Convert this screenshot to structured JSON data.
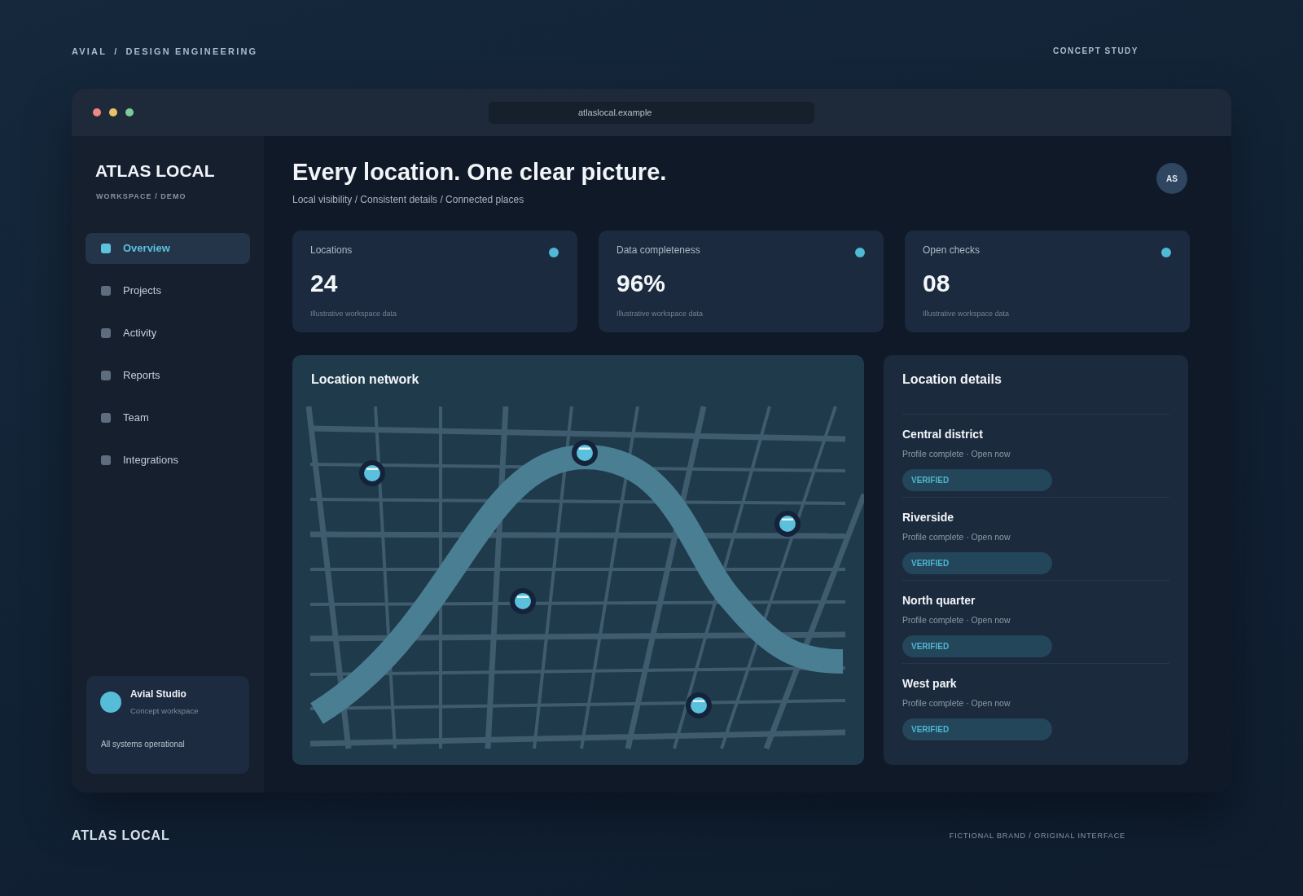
{
  "top_bar": {
    "brand": "AVIAL",
    "separator": "/",
    "section": "DESIGN ENGINEERING",
    "label": "CONCEPT STUDY"
  },
  "browser": {
    "url": "atlaslocal.example"
  },
  "sidebar": {
    "title": "ATLAS LOCAL",
    "subtitle": "WORKSPACE / DEMO",
    "items": [
      {
        "label": "Overview",
        "selected": true
      },
      {
        "label": "Projects",
        "selected": false
      },
      {
        "label": "Activity",
        "selected": false
      },
      {
        "label": "Reports",
        "selected": false
      },
      {
        "label": "Team",
        "selected": false
      },
      {
        "label": "Integrations",
        "selected": false
      }
    ],
    "workspace": {
      "name": "Avial Studio",
      "caption": "Concept workspace",
      "status": "All systems operational"
    }
  },
  "header": {
    "title": "Every location. One clear picture.",
    "subtitle": "Local visibility / Consistent details / Connected places",
    "avatar": "AS"
  },
  "stats": [
    {
      "label": "Locations",
      "value": "24",
      "note": "Illustrative workspace data"
    },
    {
      "label": "Data completeness",
      "value": "96%",
      "note": "Illustrative workspace data"
    },
    {
      "label": "Open checks",
      "value": "08",
      "note": "Illustrative workspace data"
    }
  ],
  "map": {
    "title": "Location network"
  },
  "details": {
    "title": "Location details",
    "items": [
      {
        "name": "Central district",
        "meta": "Profile complete · Open now",
        "status": "VERIFIED"
      },
      {
        "name": "Riverside",
        "meta": "Profile complete · Open now",
        "status": "VERIFIED"
      },
      {
        "name": "North quarter",
        "meta": "Profile complete · Open now",
        "status": "VERIFIED"
      },
      {
        "name": "West park",
        "meta": "Profile complete · Open now",
        "status": "VERIFIED"
      }
    ]
  },
  "footer": {
    "brand": "ATLAS LOCAL",
    "note": "FICTIONAL BRAND / ORIGINAL INTERFACE"
  }
}
